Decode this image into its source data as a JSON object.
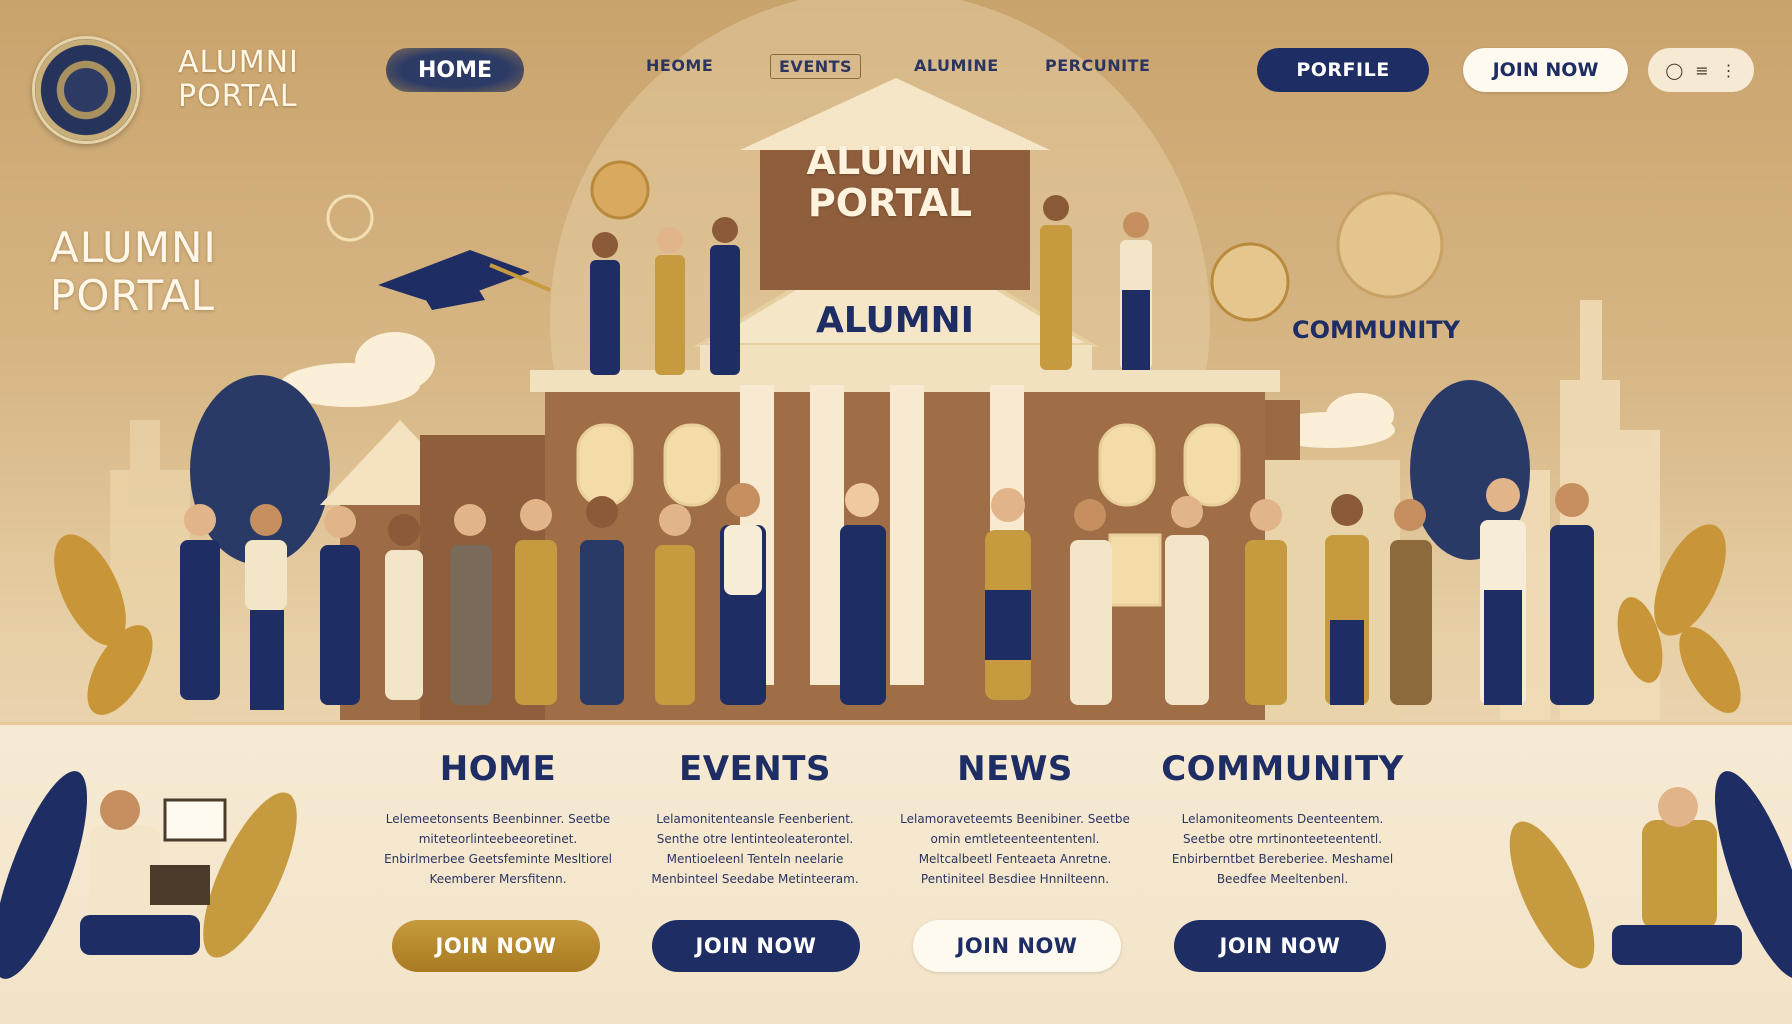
{
  "header": {
    "logo_line1": "ALUMNI",
    "logo_line2": "PORTAL",
    "nav": {
      "home": "HOME",
      "home2": "HEOME",
      "events": "EVENTS",
      "alumni": "ALUMINE",
      "percunite": "PERCUNITE"
    },
    "profile_button": "PORFILE",
    "join_button": "JOIN NOW",
    "icons": [
      "user-icon",
      "menu-icon",
      "more-icon"
    ]
  },
  "hero": {
    "title_line1": "ALUMNI",
    "title_line2": "PORTAL",
    "building_sign1": "ALUMNI",
    "building_sign2": "PORTAL",
    "building_pediment": "ALUMNI",
    "community_label": "COMMUNITY"
  },
  "sections": [
    {
      "title": "HOME",
      "text": "Lelemeetonsents Beenbinner. Seetbe miteteorlinteebeeoretinet. Enbirlmerbee Geetsfeminte Mesltiorel Keemberer Mersfitenn.",
      "button": "JOIN NOW",
      "style": "gold"
    },
    {
      "title": "EVENTS",
      "text": "Lelamonitenteansle Feenberient. Senthe otre lentinteoleaterontel. Mentioeleenl Tenteln neelarie Menbinteel Seedabe Metinteeram.",
      "button": "JOIN NOW",
      "style": "navy"
    },
    {
      "title": "NEWS",
      "text": "Lelamoraveteemts Beenibiner. Seetbe omin emtleteenteententenl. Meltcalbeetl Fenteaeta Anretne. Pentiniteel Besdiee Hnnilteenn.",
      "button": "JOIN NOW",
      "style": "light"
    },
    {
      "title": "COMMUNITY",
      "text": "Lelamoniteoments Deenteentem. Seetbe otre mrtinonteeteententl. Enbirberntbet Bereberiee. Meshamel Beedfee Meeltenbenl.",
      "button": "JOIN NOW",
      "style": "navy"
    }
  ],
  "colors": {
    "navy": "#1e2d63",
    "gold": "#c69a3e",
    "cream": "#f6ead3",
    "background": "#d8b887"
  }
}
